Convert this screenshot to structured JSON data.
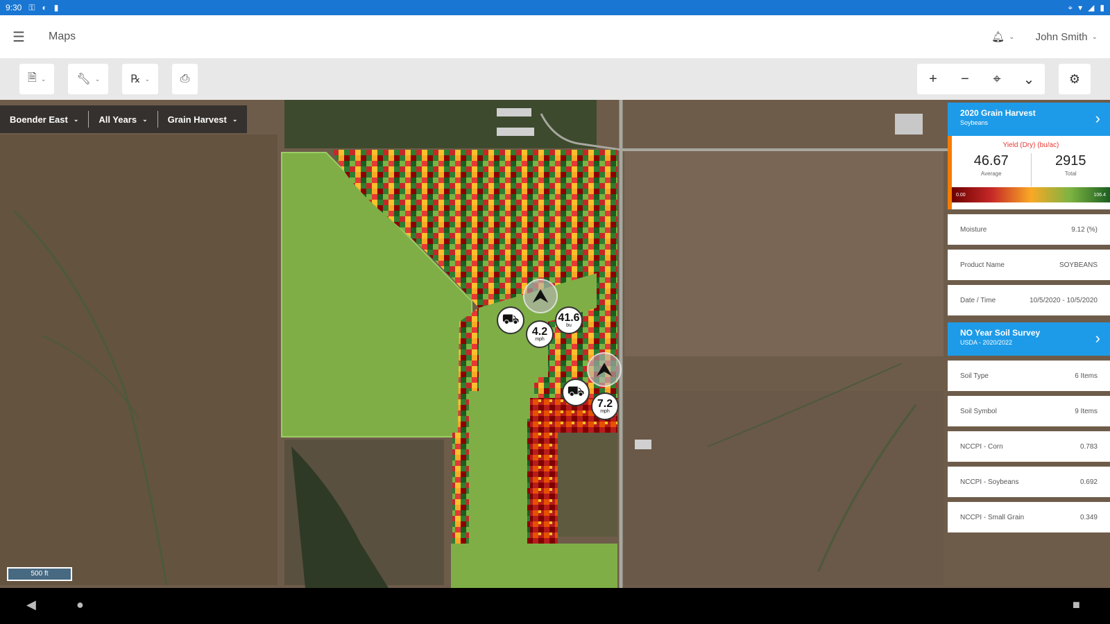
{
  "status": {
    "time": "9:30"
  },
  "header": {
    "title": "Maps",
    "user": "John Smith"
  },
  "toolbar": {
    "left_icons": [
      "document-icon",
      "wrench-icon",
      "prescription-icon",
      "print-icon"
    ],
    "zoom": [
      "+",
      "−",
      "⌖",
      "⌄"
    ],
    "settings_icon": "gear-icon"
  },
  "filters": [
    "Boender East",
    "All Years",
    "Grain Harvest"
  ],
  "scale": "500 ft",
  "markers": {
    "val1": {
      "value": "41.6",
      "unit": "bu"
    },
    "val2": {
      "value": "4.2",
      "unit": "mph"
    },
    "val3": {
      "value": "7.2",
      "unit": "mph"
    }
  },
  "panel": {
    "harvest": {
      "title": "2020 Grain Harvest",
      "subtitle": "Soybeans"
    },
    "yield_label": "Yield (Dry) (bu/ac)",
    "average": "46.67",
    "average_label": "Average",
    "total": "2915",
    "total_label": "Total",
    "grad_min": "0.00",
    "grad_max": "106.4",
    "rows": [
      {
        "label": "Moisture",
        "value": "9.12 (%)"
      },
      {
        "label": "Product Name",
        "value": "SOYBEANS"
      },
      {
        "label": "Date / Time",
        "value": "10/5/2020 - 10/5/2020"
      }
    ],
    "soil": {
      "title": "NO Year Soil Survey",
      "subtitle": "USDA - 2020/2022"
    },
    "soil_rows": [
      {
        "label": "Soil Type",
        "value": "6 Items"
      },
      {
        "label": "Soil Symbol",
        "value": "9 Items"
      },
      {
        "label": "NCCPI - Corn",
        "value": "0.783"
      },
      {
        "label": "NCCPI - Soybeans",
        "value": "0.692"
      },
      {
        "label": "NCCPI - Small Grain",
        "value": "0.349"
      }
    ]
  },
  "colors": {
    "accent": "#1e9be8",
    "status": "#1976d2"
  }
}
